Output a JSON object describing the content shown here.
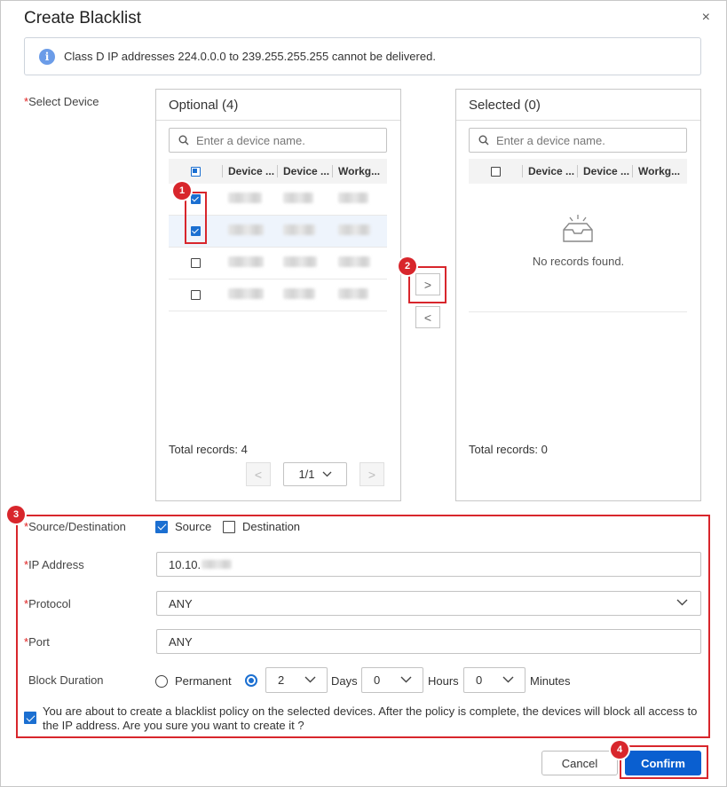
{
  "dialog": {
    "title": "Create Blacklist",
    "close_glyph": "×",
    "info_glyph": "i",
    "info_text": "Class D IP addresses 224.0.0.0 to 239.255.255.255 cannot be delivered."
  },
  "labels": {
    "required_mark": "*",
    "select_device": "Select Device",
    "source_destination": "Source/Destination",
    "ip_address": "IP Address",
    "protocol": "Protocol",
    "port": "Port",
    "block_duration": "Block Duration"
  },
  "optional_panel": {
    "title": "Optional (4)",
    "search_placeholder": "Enter a device name.",
    "columns": [
      "Device ...",
      "Device ...",
      "Workg..."
    ],
    "rows": [
      {
        "checked": true,
        "highlighted": false
      },
      {
        "checked": true,
        "highlighted": true
      },
      {
        "checked": false,
        "highlighted": false
      },
      {
        "checked": false,
        "highlighted": false
      }
    ],
    "total": "Total records: 4",
    "page": "1/1"
  },
  "selected_panel": {
    "title": "Selected (0)",
    "search_placeholder": "Enter a device name.",
    "columns": [
      "Device ...",
      "Device ...",
      "Workg..."
    ],
    "empty_text": "No records found.",
    "total": "Total records: 0"
  },
  "transfer": {
    "right_glyph": ">",
    "left_glyph": "<"
  },
  "pager": {
    "prev_glyph": "<",
    "next_glyph": ">"
  },
  "form": {
    "source_label": "Source",
    "source_checked": true,
    "destination_label": "Destination",
    "destination_checked": false,
    "ip_value": "10.10.",
    "protocol_value": "ANY",
    "port_value": "ANY",
    "permanent_label": "Permanent",
    "days_value": "2",
    "days_unit": "Days",
    "hours_value": "0",
    "hours_unit": "Hours",
    "minutes_value": "0",
    "minutes_unit": "Minutes",
    "confirm_text": "You are about to create a blacklist policy on the selected devices. After the policy is complete, the devices will block all access to the IP address. Are you sure you want to create it ?"
  },
  "buttons": {
    "cancel": "Cancel",
    "confirm": "Confirm"
  },
  "annotations": [
    "1",
    "2",
    "3",
    "4"
  ],
  "colors": {
    "accent": "#0a5fd0",
    "annotation": "#d8262c",
    "required": "#e02020"
  }
}
